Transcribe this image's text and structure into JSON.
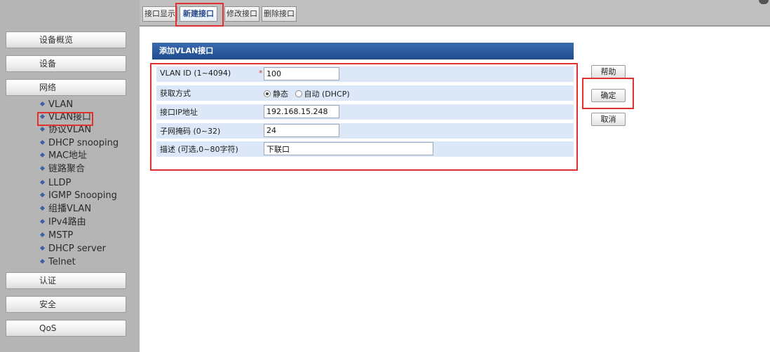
{
  "sidebar": {
    "sections": [
      {
        "label": "设备概览"
      },
      {
        "label": "设备"
      },
      {
        "label": "网络"
      },
      {
        "label": "认证"
      },
      {
        "label": "安全"
      },
      {
        "label": "QoS"
      }
    ],
    "network_items": [
      {
        "label": "VLAN"
      },
      {
        "label": "VLAN接口"
      },
      {
        "label": "协议VLAN"
      },
      {
        "label": "DHCP snooping"
      },
      {
        "label": "MAC地址"
      },
      {
        "label": "链路聚合"
      },
      {
        "label": "LLDP"
      },
      {
        "label": "IGMP Snooping"
      },
      {
        "label": "组播VLAN"
      },
      {
        "label": "IPv4路由"
      },
      {
        "label": "MSTP"
      },
      {
        "label": "DHCP server"
      },
      {
        "label": "Telnet"
      }
    ],
    "selected_item": "VLAN接口"
  },
  "tabs": [
    {
      "label": "接口显示"
    },
    {
      "label": "新建接口"
    },
    {
      "label": "修改接口"
    },
    {
      "label": "删除接口"
    }
  ],
  "active_tab": "新建接口",
  "panel": {
    "title": "添加VLAN接口",
    "fields": {
      "vlan_id": {
        "label": "VLAN ID (1~4094)",
        "required_mark": "*",
        "value": "100"
      },
      "method": {
        "label": "获取方式",
        "options": [
          "静态",
          "自动 (DHCP)"
        ],
        "selected": "静态"
      },
      "ip": {
        "label": "接口IP地址",
        "value": "192.168.15.248"
      },
      "mask": {
        "label": "子网掩码 (0~32)",
        "value": "24"
      },
      "desc": {
        "label": "描述 (可选,0~80字符)",
        "value": "下联口"
      }
    }
  },
  "buttons": {
    "help": "帮助",
    "confirm": "确定",
    "cancel": "取消"
  },
  "colors": {
    "highlight": "#e03030",
    "panel_header": "#1f4b8e",
    "row_bg": "#dce8f7",
    "sidebar_bg": "#b5b5b5"
  }
}
